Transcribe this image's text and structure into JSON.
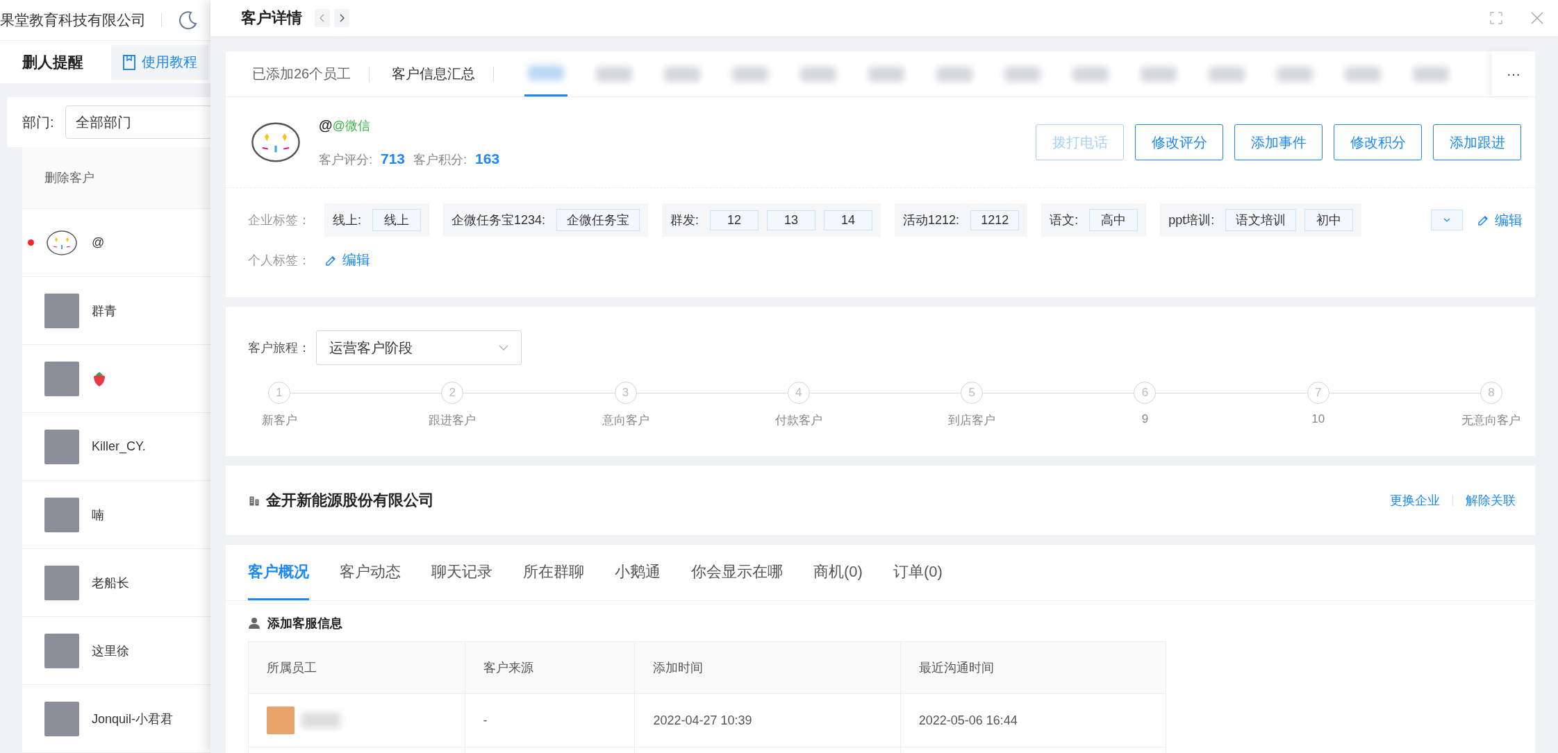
{
  "left_page": {
    "company": "果堂教育科技有限公司",
    "tab": "删人提醒",
    "tutorial_button": "使用教程",
    "filter_label": "部门:",
    "filter_value": "全部部门",
    "list_header": "删除客户",
    "rows": [
      {
        "name": "@",
        "kind": "cartoon",
        "unread": true
      },
      {
        "name": "群青",
        "kind": "photo",
        "unread": false
      },
      {
        "kind": "strawberry",
        "unread": false
      },
      {
        "name": "Killer_CY.",
        "kind": "photo",
        "unread": false
      },
      {
        "name": "喃",
        "kind": "photo",
        "unread": false
      },
      {
        "name": "老船长",
        "kind": "photo",
        "unread": false
      },
      {
        "name": "这里徐",
        "kind": "photo",
        "unread": false
      },
      {
        "name": "Jonquil-小君君",
        "kind": "photo",
        "unread": false
      }
    ]
  },
  "drawer": {
    "title": "客户详情",
    "summary_tabs": [
      "已添加26个员工",
      "客户信息汇总"
    ],
    "staff_tabs": [
      {
        "selected": true
      },
      {
        "selected": false
      },
      {
        "selected": false
      },
      {
        "selected": false
      },
      {
        "selected": false
      },
      {
        "selected": false
      },
      {
        "selected": false
      },
      {
        "selected": false
      },
      {
        "selected": false
      },
      {
        "selected": false
      },
      {
        "selected": false
      },
      {
        "selected": false
      },
      {
        "selected": false
      },
      {
        "selected": false
      }
    ],
    "more": "···",
    "profile": {
      "name": "@",
      "source": "@微信",
      "score_label": "客户评分:",
      "score": "713",
      "points_label": "客户积分:",
      "points": "163"
    },
    "actions": [
      {
        "label": "拨打电话",
        "disabled": true
      },
      {
        "label": "修改评分",
        "disabled": false
      },
      {
        "label": "添加事件",
        "disabled": false
      },
      {
        "label": "修改积分",
        "disabled": false
      },
      {
        "label": "添加跟进",
        "disabled": false
      }
    ],
    "corp_tags_label": "企业标签：",
    "tag_groups": [
      {
        "name": "线上:",
        "tags": [
          "线上"
        ]
      },
      {
        "name": "企微任务宝1234:",
        "tags": [
          "企微任务宝"
        ]
      },
      {
        "name": "群发:",
        "tags": [
          "12",
          "13",
          "14"
        ]
      },
      {
        "name": "活动1212:",
        "tags": [
          "1212"
        ]
      },
      {
        "name": "语文:",
        "tags": [
          "高中"
        ]
      },
      {
        "name": "ppt培训:",
        "tags": [
          "语文培训",
          "初中"
        ]
      }
    ],
    "edit_corp": "编辑",
    "personal_tags_label": "个人标签：",
    "edit_personal": "编辑",
    "journey": {
      "label": "客户旅程：",
      "value": "运营客户阶段",
      "steps": [
        {
          "number": "1",
          "name": "新客户"
        },
        {
          "number": "2",
          "name": "跟进客户"
        },
        {
          "number": "3",
          "name": "意向客户"
        },
        {
          "number": "4",
          "name": "付款客户"
        },
        {
          "number": "5",
          "name": "到店客户"
        },
        {
          "number": "6",
          "name": "9"
        },
        {
          "number": "7",
          "name": "10"
        },
        {
          "number": "8",
          "name": "无意向客户"
        }
      ]
    },
    "company": {
      "name": "金开新能源股份有限公司",
      "links": [
        "更换企业",
        "解除关联"
      ]
    },
    "tabs": [
      {
        "label": "客户概况",
        "selected": true
      },
      {
        "label": "客户动态",
        "selected": false
      },
      {
        "label": "聊天记录",
        "selected": false
      },
      {
        "label": "所在群聊",
        "selected": false
      },
      {
        "label": "小鹅通",
        "selected": false
      },
      {
        "label": "你会显示在哪",
        "selected": false
      },
      {
        "label": "商机(0)",
        "selected": false
      },
      {
        "label": "订单(0)",
        "selected": false
      }
    ],
    "section_title": "添加客服信息",
    "table": {
      "columns": [
        "所属员工",
        "客户来源",
        "添加时间",
        "最近沟通时间"
      ],
      "rows": [
        {
          "source": "-",
          "added": "2022-04-27 10:39",
          "last_contact": "2022-05-06 16:44"
        }
      ]
    }
  }
}
